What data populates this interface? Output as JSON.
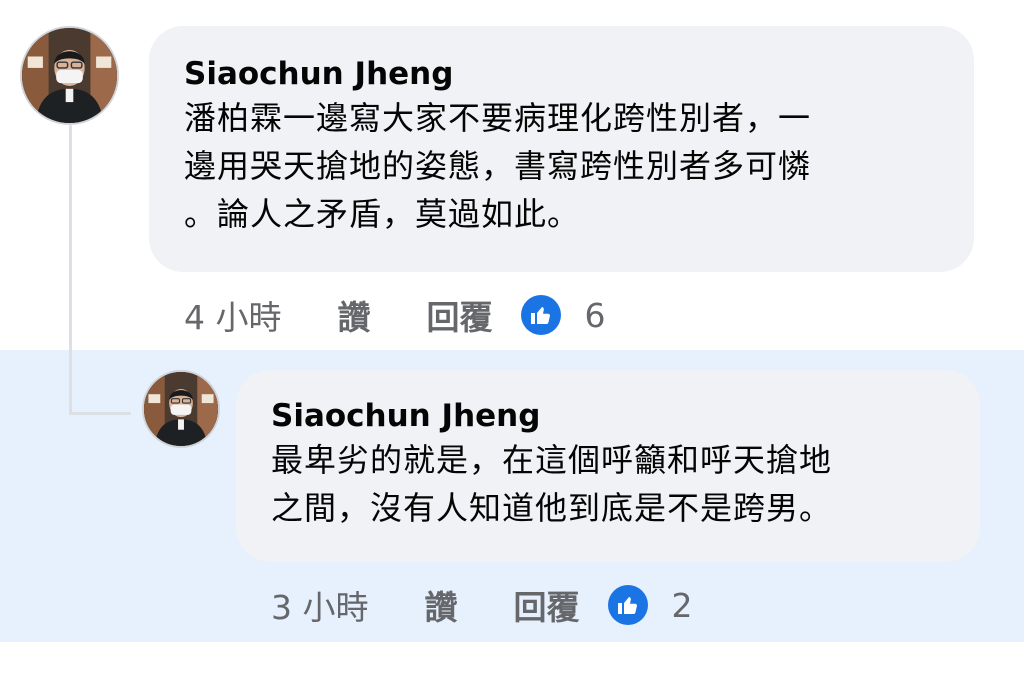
{
  "comment": {
    "author": "Siaochun Jheng",
    "text_lines": [
      "潘柏霖一邊寫大家不要病理化跨性別者，一",
      "邊用哭天搶地的姿態，書寫跨性別者多可憐",
      "。論人之矛盾，莫過如此。"
    ],
    "time": "4 小時",
    "like_label": "讚",
    "reply_label": "回覆",
    "reaction_icon": "thumbs-up-icon",
    "reaction_count": "6"
  },
  "reply": {
    "author": "Siaochun Jheng",
    "text_lines": [
      "最卑劣的就是，在這個呼籲和呼天搶地",
      "之間，沒有人知道他到底是不是跨男。"
    ],
    "time": "3 小時",
    "like_label": "讚",
    "reply_label": "回覆",
    "reaction_icon": "thumbs-up-icon",
    "reaction_count": "2"
  },
  "colors": {
    "bubble": "#f0f2f5",
    "highlight": "#e7f0fd",
    "meta_text": "#65676b",
    "like_blue": "#1b74e4",
    "thread_line": "#dcdfe4"
  }
}
